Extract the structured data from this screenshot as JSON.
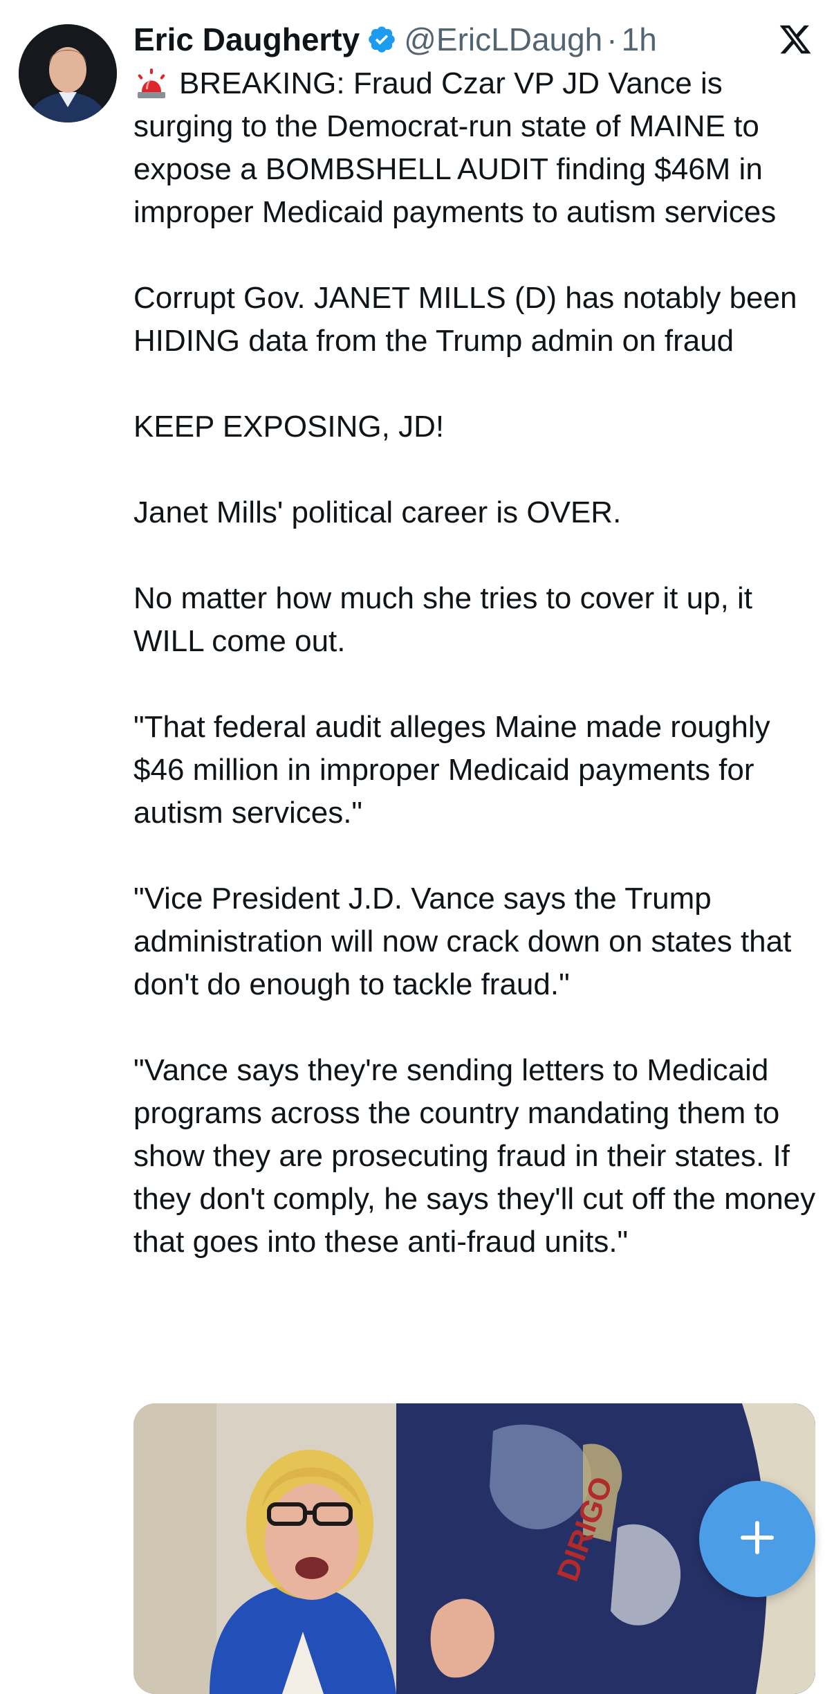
{
  "tweet": {
    "author": {
      "display_name": "Eric Daugherty",
      "handle": "@EricLDaugh",
      "separator": "·",
      "time": "1h",
      "verified_color": "#1d9bf0"
    },
    "close_icon": "x-logo-icon",
    "text": {
      "p1": "BREAKING: Fraud Czar VP JD Vance is surging to the Democrat-run state of MAINE to expose a BOMBSHELL AUDIT finding $46M in improper Medicaid payments to autism services",
      "p2": "Corrupt Gov. JANET MILLS (D) has notably been HIDING data from the Trump admin on fraud",
      "p3": "KEEP EXPOSING, JD!",
      "p4": "Janet Mills' political career is OVER.",
      "p5": "No matter how much she tries to cover it up, it WILL come out.",
      "p6": "\"That federal audit alleges Maine made roughly $46 million in improper Medicaid payments for autism services.\"",
      "p7": "\"Vice President J.D. Vance says the Trump administration will now crack down on states that don't do enough to tackle fraud.\"",
      "p8": "\"Vance says they're sending letters to Medicaid programs across the country mandating them to show they are prosecuting fraud in their states. If they don't comply, he says they'll cut off the money that goes into these anti-fraud units.\""
    },
    "media": {
      "flag_text": "DIRIGO"
    }
  },
  "fab": {
    "icon": "plus-icon",
    "color": "#4c9de8"
  }
}
